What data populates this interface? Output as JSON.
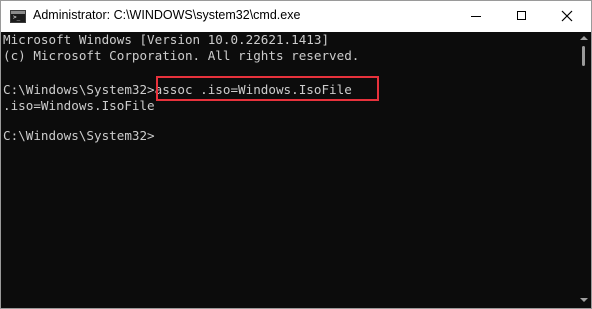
{
  "window": {
    "title": "Administrator: C:\\WINDOWS\\system32\\cmd.exe",
    "icon": "cmd-app-icon",
    "icon_prompt": ">_"
  },
  "controls": {
    "minimize_icon": "minimize-icon",
    "maximize_icon": "maximize-icon",
    "close_icon": "close-icon"
  },
  "terminal": {
    "lines": [
      "Microsoft Windows [Version 10.0.22621.1413]",
      "(c) Microsoft Corporation. All rights reserved.",
      "C:\\Windows\\System32>assoc .iso=Windows.IsoFile",
      ".iso=Windows.IsoFile",
      "C:\\Windows\\System32>"
    ],
    "highlighted_command": "assoc .iso=Windows.IsoFile"
  },
  "colors": {
    "terminal_bg": "#0c0c0c",
    "terminal_text": "#cccccc",
    "highlight_border": "#e8323c",
    "titlebar_bg": "#ffffff"
  }
}
